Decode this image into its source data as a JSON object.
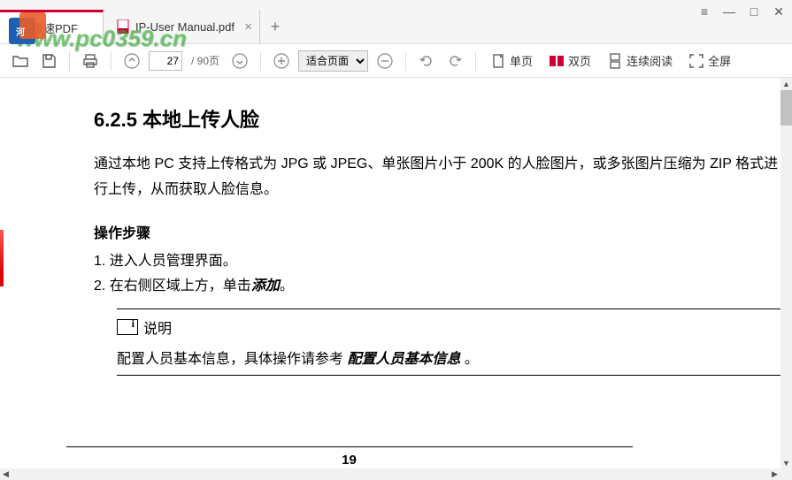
{
  "window": {
    "app_tab": "极速PDF",
    "file_tab": "IP-User Manual.pdf"
  },
  "toolbar": {
    "current_page": "27",
    "total_pages": "/ 90页",
    "zoom_mode": "适合页面",
    "single_page": "单页",
    "double_page": "双页",
    "continuous": "连续阅读",
    "fullscreen": "全屏"
  },
  "doc": {
    "heading": "6.2.5  本地上传人脸",
    "paragraph": "通过本地 PC 支持上传格式为 JPG 或 JPEG、单张图片小于 200K 的人脸图片，或多张图片压缩为 ZIP 格式进行上传，从而获取人脸信息。",
    "steps_title": "操作步骤",
    "step1_num": "1. ",
    "step1_text": "进入人员管理界面。",
    "step2_num": "2. ",
    "step2_text_a": "在右侧区域上方，单击",
    "step2_bold": "添加",
    "step2_text_b": "。",
    "note_label": "说明",
    "note_text_a": "配置人员基本信息，具体操作请参考 ",
    "note_ref": "配置人员基本信息",
    "note_text_b": " 。",
    "page_number": "19"
  },
  "watermark": "www.pc0359.cn"
}
